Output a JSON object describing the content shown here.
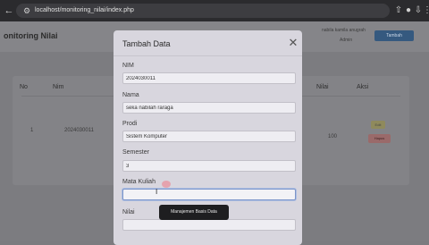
{
  "browser": {
    "url": "localhost/monitoring_nilai/index.php",
    "back_icon": "back-arrow-icon",
    "info_icon": "site-info-icon",
    "extension_icons": [
      "upload-icon",
      "profile-icon",
      "download-icon",
      "menu-icon"
    ]
  },
  "page": {
    "title": "onitoring Nilai",
    "user_name": "nabila kamila anugrah",
    "user_role": "Admin",
    "add_button": "Tambah",
    "table": {
      "headers": [
        "No",
        "Nim",
        "Nilai",
        "Aksi"
      ],
      "row": {
        "no": "1",
        "nim": "2024030011",
        "nilai": "100",
        "edit": "Edit",
        "delete": "Hapus"
      }
    }
  },
  "modal": {
    "title": "Tambah Data",
    "close_icon": "close-icon",
    "fields": {
      "nim": {
        "label": "NIM",
        "value": "2024030011"
      },
      "nama": {
        "label": "Nama",
        "value": "seka nabilah raraga"
      },
      "prodi": {
        "label": "Prodi",
        "value": "Sistem Komputer"
      },
      "semester": {
        "label": "Semester",
        "value": "3"
      },
      "mata_kuliah": {
        "label": "Mata Kuliah",
        "value": ""
      },
      "nilai": {
        "label": "Nilai",
        "value": ""
      }
    },
    "tooltip": "Manajemen Basis Data"
  },
  "colors": {
    "overlay": "#7b7b7f",
    "modal_bg": "#d8d6de",
    "primary_button": "#35597f",
    "focus_border": "#7c95c9"
  }
}
